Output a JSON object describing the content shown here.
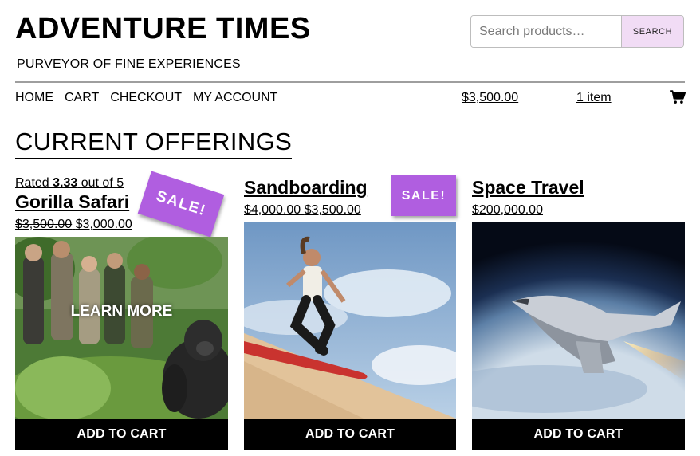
{
  "site": {
    "title": "ADVENTURE TIMES",
    "tagline": "PURVEYOR OF FINE EXPERIENCES"
  },
  "search": {
    "placeholder": "Search products…",
    "button_label": "SEARCH"
  },
  "nav": {
    "items": [
      {
        "label": "HOME"
      },
      {
        "label": "CART"
      },
      {
        "label": "CHECKOUT"
      },
      {
        "label": "MY ACCOUNT"
      }
    ]
  },
  "cart": {
    "total": "$3,500.00",
    "count": "1 item",
    "icon": "cart-icon"
  },
  "section": {
    "title": "CURRENT OFFERINGS"
  },
  "products": [
    {
      "rating_prefix": "Rated ",
      "rating_value": "3.33",
      "rating_suffix": " out of 5",
      "title": "Gorilla Safari",
      "old_price": "$3,500.00",
      "price": "$3,000.00",
      "sale_badge": "SALE!",
      "overlay": "LEARN MORE",
      "button": "ADD TO CART"
    },
    {
      "title": "Sandboarding",
      "old_price": "$4,000.00",
      "price": "$3,500.00",
      "sale_badge": "SALE!",
      "button": "ADD TO CART"
    },
    {
      "title": "Space Travel",
      "price": "$200,000.00",
      "button": "ADD TO CART"
    }
  ],
  "colors": {
    "sale_badge": "#b05ee0",
    "search_button": "#f1dcf5",
    "add_to_cart": "#000000"
  }
}
